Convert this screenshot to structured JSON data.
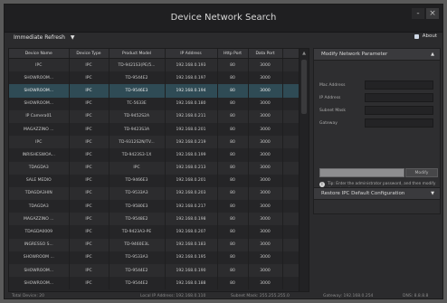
{
  "window": {
    "title": "Device Network Search",
    "controls": [
      "-",
      "×"
    ]
  },
  "toolbar": {
    "filter_label": "Immediate Refresh"
  },
  "grid": {
    "columns": [
      "Device Name",
      "Device Type",
      "Product Model",
      "IP Address",
      "Http Port",
      "Data Port"
    ],
    "rows": [
      [
        "IPC",
        "IPC",
        "TD-9421S3(PE/5...",
        "192.168.0.193",
        "80",
        "3000"
      ],
      [
        "SHOWROOM...",
        "IPC",
        "TD-9544E2",
        "192.168.0.197",
        "80",
        "3000"
      ],
      [
        "SHOWROOM...",
        "IPC",
        "TD-9546E3",
        "192.168.0.194",
        "80",
        "3000"
      ],
      [
        "SHOWROOM...",
        "IPC",
        "TC-5633E",
        "192.168.0.180",
        "80",
        "3000"
      ],
      [
        "IP Camera01",
        "IPC",
        "TD-9452S2A",
        "192.168.0.211",
        "80",
        "3000"
      ],
      [
        "MAGAZZINO ...",
        "IPC",
        "TD-9423S3A",
        "192.168.0.201",
        "80",
        "3000"
      ],
      [
        "IPC",
        "IPC",
        "TD-9312S2N/TV...",
        "192.168.0.219",
        "80",
        "3000"
      ],
      [
        "INRISHESWOA...",
        "IPC",
        "TD-9423S3-1X",
        "192.168.0.199",
        "80",
        "3000"
      ],
      [
        "TDAGDA3",
        "IPC",
        "IPC",
        "192.168.0.213",
        "80",
        "3000"
      ],
      [
        "SALE MEDIO",
        "IPC",
        "TD-9466E3",
        "192.168.0.201",
        "80",
        "3000"
      ],
      [
        "TDAGDA3HIN",
        "IPC",
        "TD-9533A3",
        "192.168.0.203",
        "80",
        "3000"
      ],
      [
        "TDAGDA3",
        "IPC",
        "TD-9580E3",
        "192.168.0.217",
        "80",
        "3000"
      ],
      [
        "MAGAZZINO ...",
        "IPC",
        "TD-9548E2",
        "192.168.0.198",
        "80",
        "3000"
      ],
      [
        "TDAGDA0009",
        "IPC",
        "TD-9423A3-PE",
        "192.168.0.207",
        "80",
        "3000"
      ],
      [
        "INGRESSO S...",
        "IPC",
        "TD-9460E3L",
        "192.168.0.183",
        "80",
        "3000"
      ],
      [
        "SHOWROOM ...",
        "IPC",
        "TD-9533A3",
        "192.168.0.195",
        "80",
        "3000"
      ],
      [
        "SHOWROOM...",
        "IPC",
        "TD-9544E2",
        "192.168.0.190",
        "80",
        "3000"
      ],
      [
        "SHOWROOM...",
        "IPC",
        "TD-9544E2",
        "192.168.0.188",
        "80",
        "3000"
      ]
    ],
    "selected_row": 2
  },
  "status": {
    "total": "Total Device: 20",
    "local_ip": "Local IP Address: 192.168.0.110",
    "subnet": "Subnet Mask: 255.255.255.0",
    "gateway": "Gateway: 192.168.0.254",
    "dns": "DNS: 8.8.8.8"
  },
  "about_label": "About",
  "modify_panel": {
    "title": "Modify Network Parameter",
    "toggle": "▲",
    "fields": [
      {
        "label": "Mac Address"
      },
      {
        "label": "IP Address"
      },
      {
        "label": "Subnet Mask"
      },
      {
        "label": "Gateway"
      }
    ],
    "modify_button": "Modify",
    "tip_icon": "i",
    "tip": "Tip: Enter the administrator password, and then modify the network parameters."
  },
  "restore_panel": {
    "title": "Restore IPC Default Configuration",
    "toggle": "▼"
  }
}
